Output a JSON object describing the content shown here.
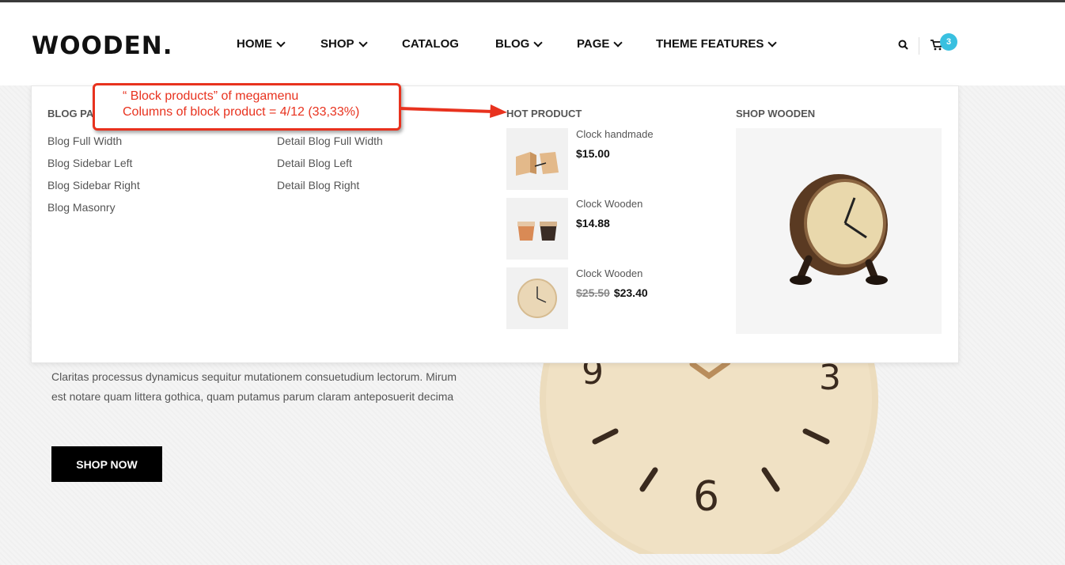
{
  "header": {
    "logo": "WOODEN.",
    "nav": [
      "HOME",
      "SHOP",
      "CATALOG",
      "BLOG",
      "PAGE",
      "THEME FEATURES"
    ],
    "cart_count": "3"
  },
  "megamenu": {
    "col1_title": "BLOG PA",
    "col1_links": [
      "Blog Full Width",
      "Blog Sidebar Left",
      "Blog Sidebar Right",
      "Blog Masonry"
    ],
    "col2_links": [
      "Detail Blog Full Width",
      "Detail Blog Left",
      "Detail Blog Right"
    ],
    "hot_title": "HOT PRODUCT",
    "products": [
      {
        "name": "Clock handmade",
        "price": "$15.00",
        "old_price": ""
      },
      {
        "name": "Clock Wooden",
        "price": "$14.88",
        "old_price": ""
      },
      {
        "name": "Clock Wooden",
        "price": "$23.40",
        "old_price": "$25.50"
      }
    ],
    "shop_title": "SHOP WOODEN"
  },
  "annotation": {
    "line1": "“ Block products” of megamenu",
    "line2": "Columns of block product = 4/12 (33,33%)"
  },
  "hero": {
    "text": "Claritas processus dynamicus sequitur mutationem consuetudium lectorum. Mirum est notare quam littera gothica, quam putamus parum claram anteposuerit decima",
    "button": "SHOP NOW"
  },
  "colors": {
    "accent": "#39c0e0",
    "annotation": "#e8321e"
  }
}
